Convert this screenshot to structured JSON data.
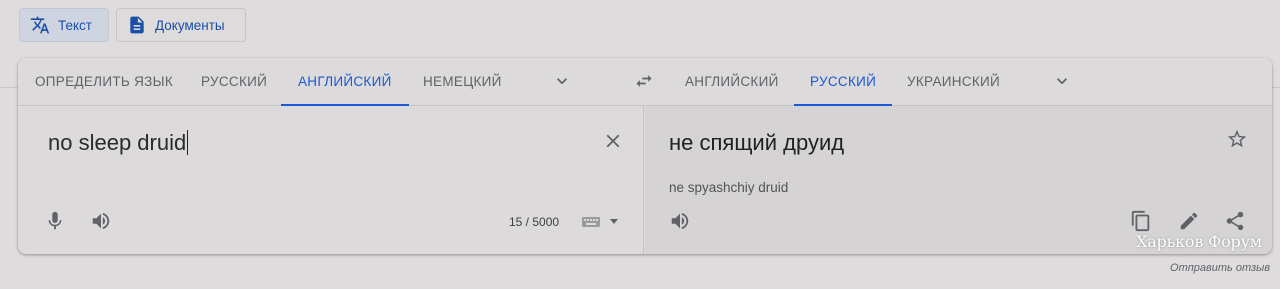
{
  "mode_buttons": {
    "text": {
      "label": "Текст",
      "icon": "translate-icon",
      "active": true
    },
    "docs": {
      "label": "Документы",
      "icon": "document-icon",
      "active": false
    }
  },
  "source_langs": {
    "tabs": [
      {
        "label": "ОПРЕДЕЛИТЬ ЯЗЫК",
        "active": false
      },
      {
        "label": "РУССКИЙ",
        "active": false
      },
      {
        "label": "АНГЛИЙСКИЙ",
        "active": true
      },
      {
        "label": "НЕМЕЦКИЙ",
        "active": false
      }
    ],
    "more_icon": "chevron-down-icon"
  },
  "swap_icon": "swap-icon",
  "target_langs": {
    "tabs": [
      {
        "label": "АНГЛИЙСКИЙ",
        "active": false
      },
      {
        "label": "РУССКИЙ",
        "active": true
      },
      {
        "label": "УКРАИНСКИЙ",
        "active": false
      }
    ],
    "more_icon": "chevron-down-icon"
  },
  "source": {
    "text": "no sleep druid",
    "char_count": "15 / 5000",
    "icons": [
      "close-icon",
      "mic-icon",
      "speaker-icon",
      "keyboard-icon"
    ]
  },
  "target": {
    "text": "не спящий друид",
    "transliteration": "ne spyashchiy druid",
    "icons": [
      "star-icon",
      "speaker-icon",
      "copy-icon",
      "edit-icon",
      "share-icon"
    ]
  },
  "watermark": "Харьков Форум",
  "feedback_link": "Отправить отзыв",
  "colors": {
    "accent": "#1a5ad4",
    "background": "#dedcdc",
    "panel_right": "#d5d3d3"
  }
}
